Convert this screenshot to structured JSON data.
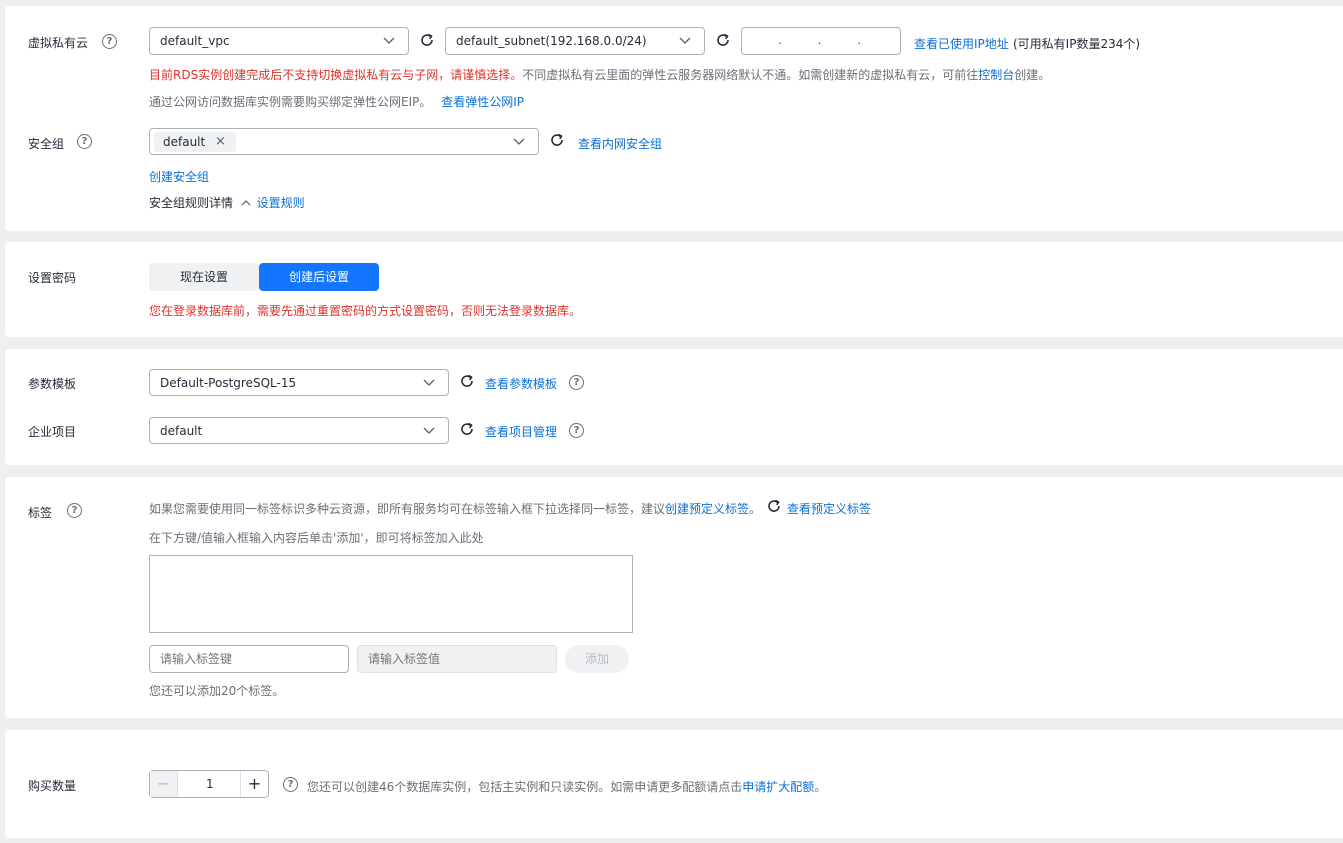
{
  "vpc": {
    "label": "虚拟私有云",
    "vpc_value": "default_vpc",
    "subnet_value": "default_subnet(192.168.0.0/24)",
    "ip_dots": ".  .  .",
    "view_ip_link": "查看已使用IP地址",
    "ip_count_text": "(可用私有IP数量234个)",
    "warn_text": "目前RDS实例创建完成后不支持切换虚拟私有云与子网，请谨慎选择。",
    "info_text_1": "不同虚拟私有云里面的弹性云服务器网络默认不通。如需创建新的虚拟私有云，可前往",
    "console_link": "控制台",
    "info_text_2": "创建。",
    "eip_text": "通过公网访问数据库实例需要购买绑定弹性公网EIP。",
    "eip_link": "查看弹性公网IP"
  },
  "security": {
    "label": "安全组",
    "tag_value": "default",
    "view_link": "查看内网安全组",
    "create_link": "创建安全组",
    "rules_label": "安全组规则详情",
    "rules_link": "设置规则"
  },
  "password": {
    "label": "设置密码",
    "option_now": "现在设置",
    "option_later": "创建后设置",
    "warn_text": "您在登录数据库前，需要先通过重置密码的方式设置密码，否则无法登录数据库。"
  },
  "params": {
    "label": "参数模板",
    "value": "Default-PostgreSQL-15",
    "view_link": "查看参数模板"
  },
  "enterprise": {
    "label": "企业项目",
    "value": "default",
    "view_link": "查看项目管理"
  },
  "tags": {
    "label": "标签",
    "hint_1": "如果您需要使用同一标签标识多种云资源，即所有服务均可在标签输入框下拉选择同一标签，建议",
    "create_link": "创建预定义标签",
    "hint_2": "。",
    "view_link": "查看预定义标签",
    "instruction": "在下方键/值输入框输入内容后单击'添加'，即可将标签加入此处",
    "key_placeholder": "请输入标签键",
    "value_placeholder": "请输入标签值",
    "add_button": "添加",
    "remaining": "您还可以添加20个标签。"
  },
  "purchase": {
    "label": "购买数量",
    "quantity": "1",
    "info_text": "您还可以创建46个数据库实例，包括主实例和只读实例。如需申请更多配额请点击",
    "quota_link": "申请扩大配额",
    "info_end": "。"
  },
  "colors": {
    "accent": "#0c6fd6",
    "primary_button": "#1476ff",
    "warning": "#e0322c"
  }
}
